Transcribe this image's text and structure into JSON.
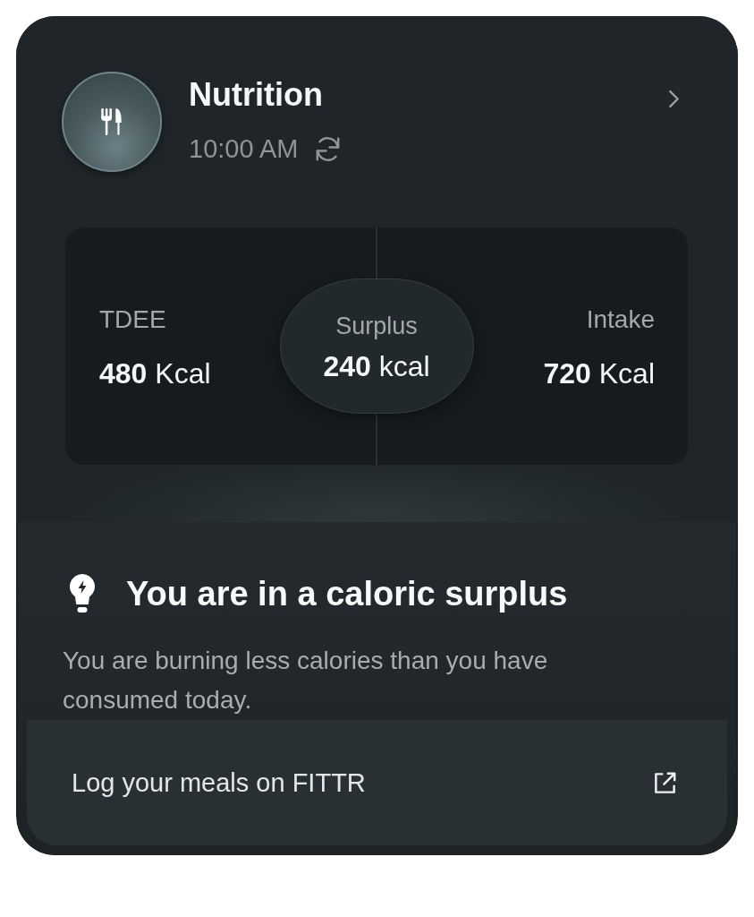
{
  "header": {
    "title": "Nutrition",
    "time": "10:00 AM"
  },
  "stats": {
    "tdee": {
      "label": "TDEE",
      "value": "**480** Kcal"
    },
    "surplus": {
      "label": "Surplus",
      "value": "**240** kcal"
    },
    "intake": {
      "label": "Intake",
      "value": "**720** Kcal"
    }
  },
  "insight": {
    "title": "You are in a caloric surplus",
    "message": "You are burning less calories than you have consumed today."
  },
  "footer_link": {
    "label": "Log your meals on FITTR"
  }
}
